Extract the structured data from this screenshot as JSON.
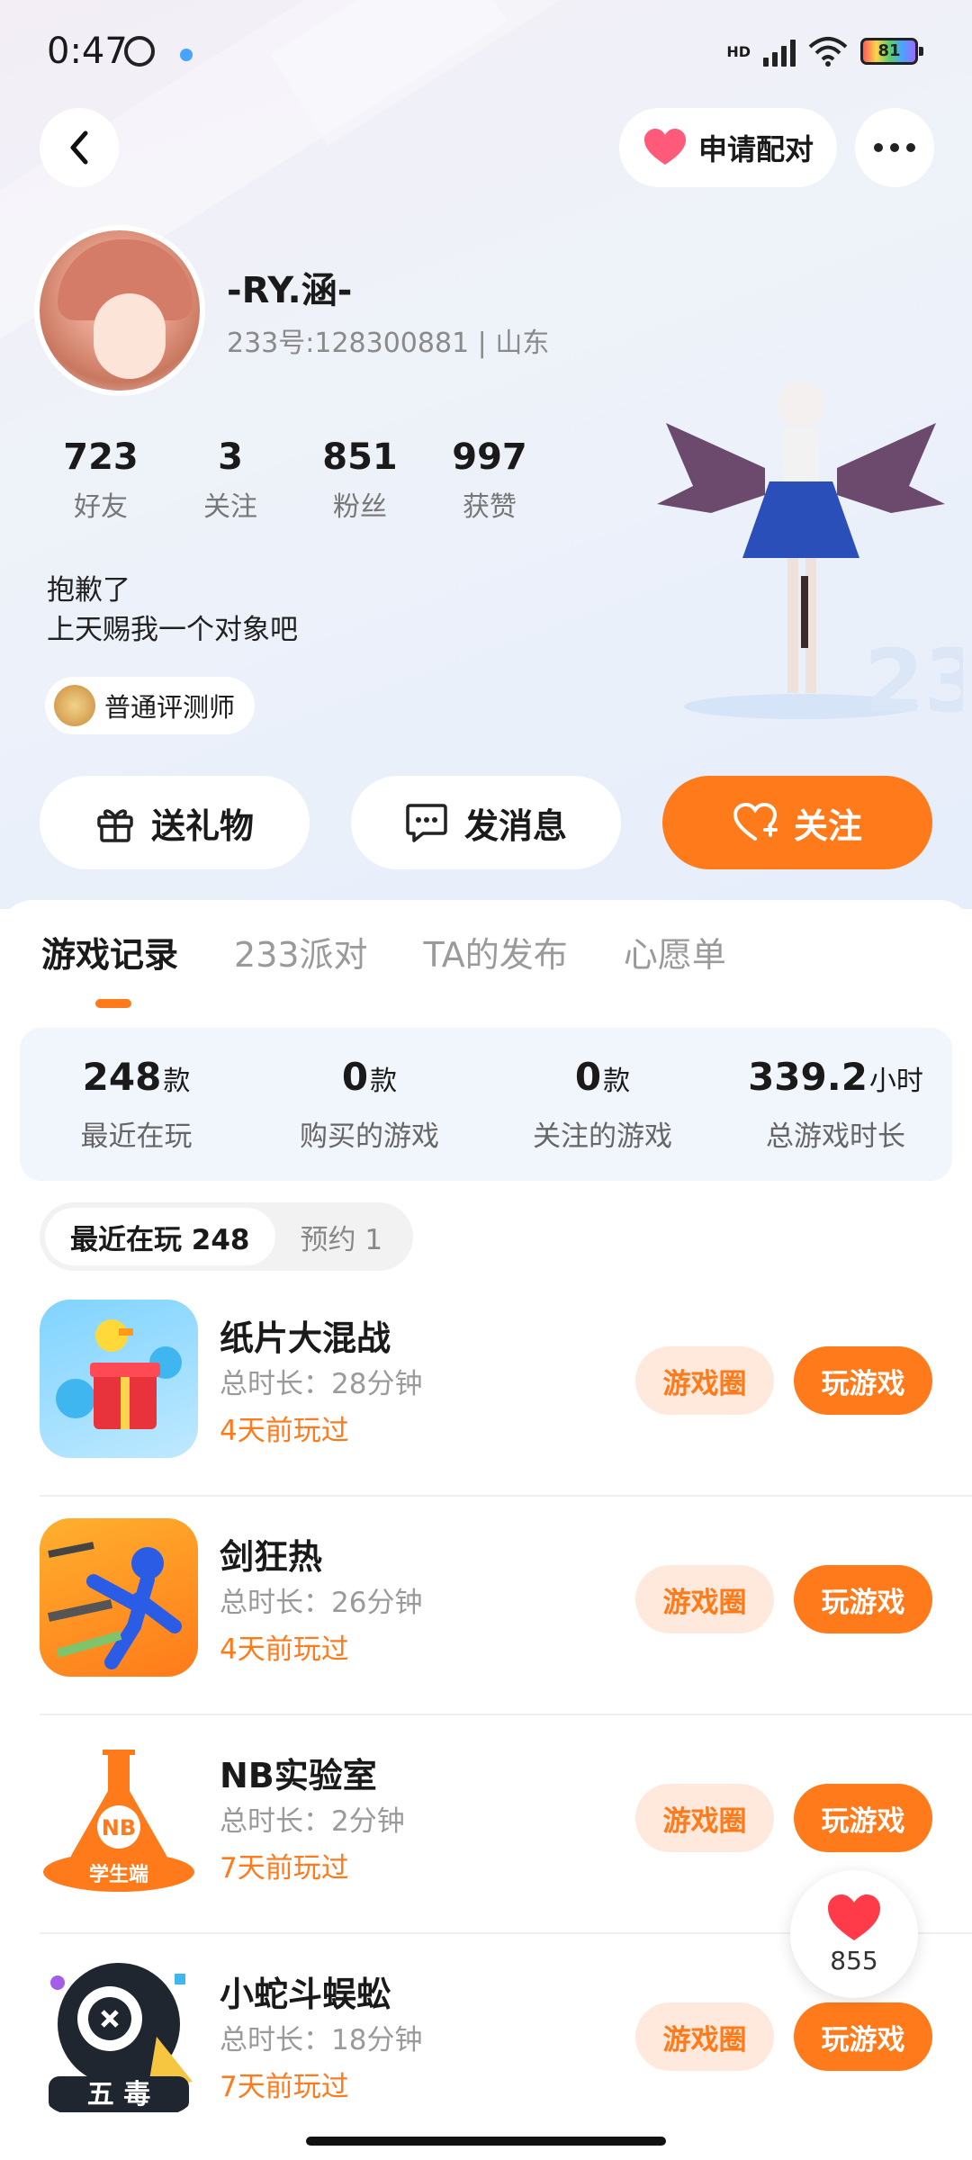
{
  "status": {
    "time": "0:47",
    "battery": "81",
    "network": "HD"
  },
  "header": {
    "pair_label": "申请配对"
  },
  "profile": {
    "name": "-RY.涵-",
    "id_line": "233号:128300881 | 山东",
    "stats": [
      {
        "value": "723",
        "label": "好友"
      },
      {
        "value": "3",
        "label": "关注"
      },
      {
        "value": "851",
        "label": "粉丝"
      },
      {
        "value": "997",
        "label": "获赞"
      }
    ],
    "bio_line1": "抱歉了",
    "bio_line2": "上天赐我一个对象吧",
    "badge": "普通评测师"
  },
  "actions": {
    "gift": "送礼物",
    "message": "发消息",
    "follow": "关注"
  },
  "tabs": [
    "游戏记录",
    "233派对",
    "TA的发布",
    "心愿单"
  ],
  "summary": [
    {
      "value": "248",
      "unit": "款",
      "label": "最近在玩"
    },
    {
      "value": "0",
      "unit": "款",
      "label": "购买的游戏"
    },
    {
      "value": "0",
      "unit": "款",
      "label": "关注的游戏"
    },
    {
      "value": "339.2",
      "unit": "小时",
      "label": "总游戏时长"
    }
  ],
  "filters": [
    {
      "label": "最近在玩 248"
    },
    {
      "label": "预约 1"
    }
  ],
  "games": [
    {
      "name": "纸片大混战",
      "duration": "总时长：28分钟",
      "played": "4天前玩过",
      "circle": "游戏圈",
      "play": "玩游戏"
    },
    {
      "name": "剑狂热",
      "duration": "总时长：26分钟",
      "played": "4天前玩过",
      "circle": "游戏圈",
      "play": "玩游戏"
    },
    {
      "name": "NB实验室",
      "duration": "总时长：2分钟",
      "played": "7天前玩过",
      "circle": "游戏圈",
      "play": "玩游戏",
      "icon_text_top": "NB",
      "icon_text_bottom": "学生端"
    },
    {
      "name": "小蛇斗蜈蚣",
      "duration": "总时长：18分钟",
      "played": "7天前玩过",
      "circle": "游戏圈",
      "play": "玩游戏",
      "icon_text_bottom": "五 毒"
    }
  ],
  "like_float": {
    "count": "855"
  },
  "colors": {
    "accent": "#ff7a1a",
    "accent_light": "#ffe9dc",
    "summary_bg": "#f1f5fc"
  }
}
